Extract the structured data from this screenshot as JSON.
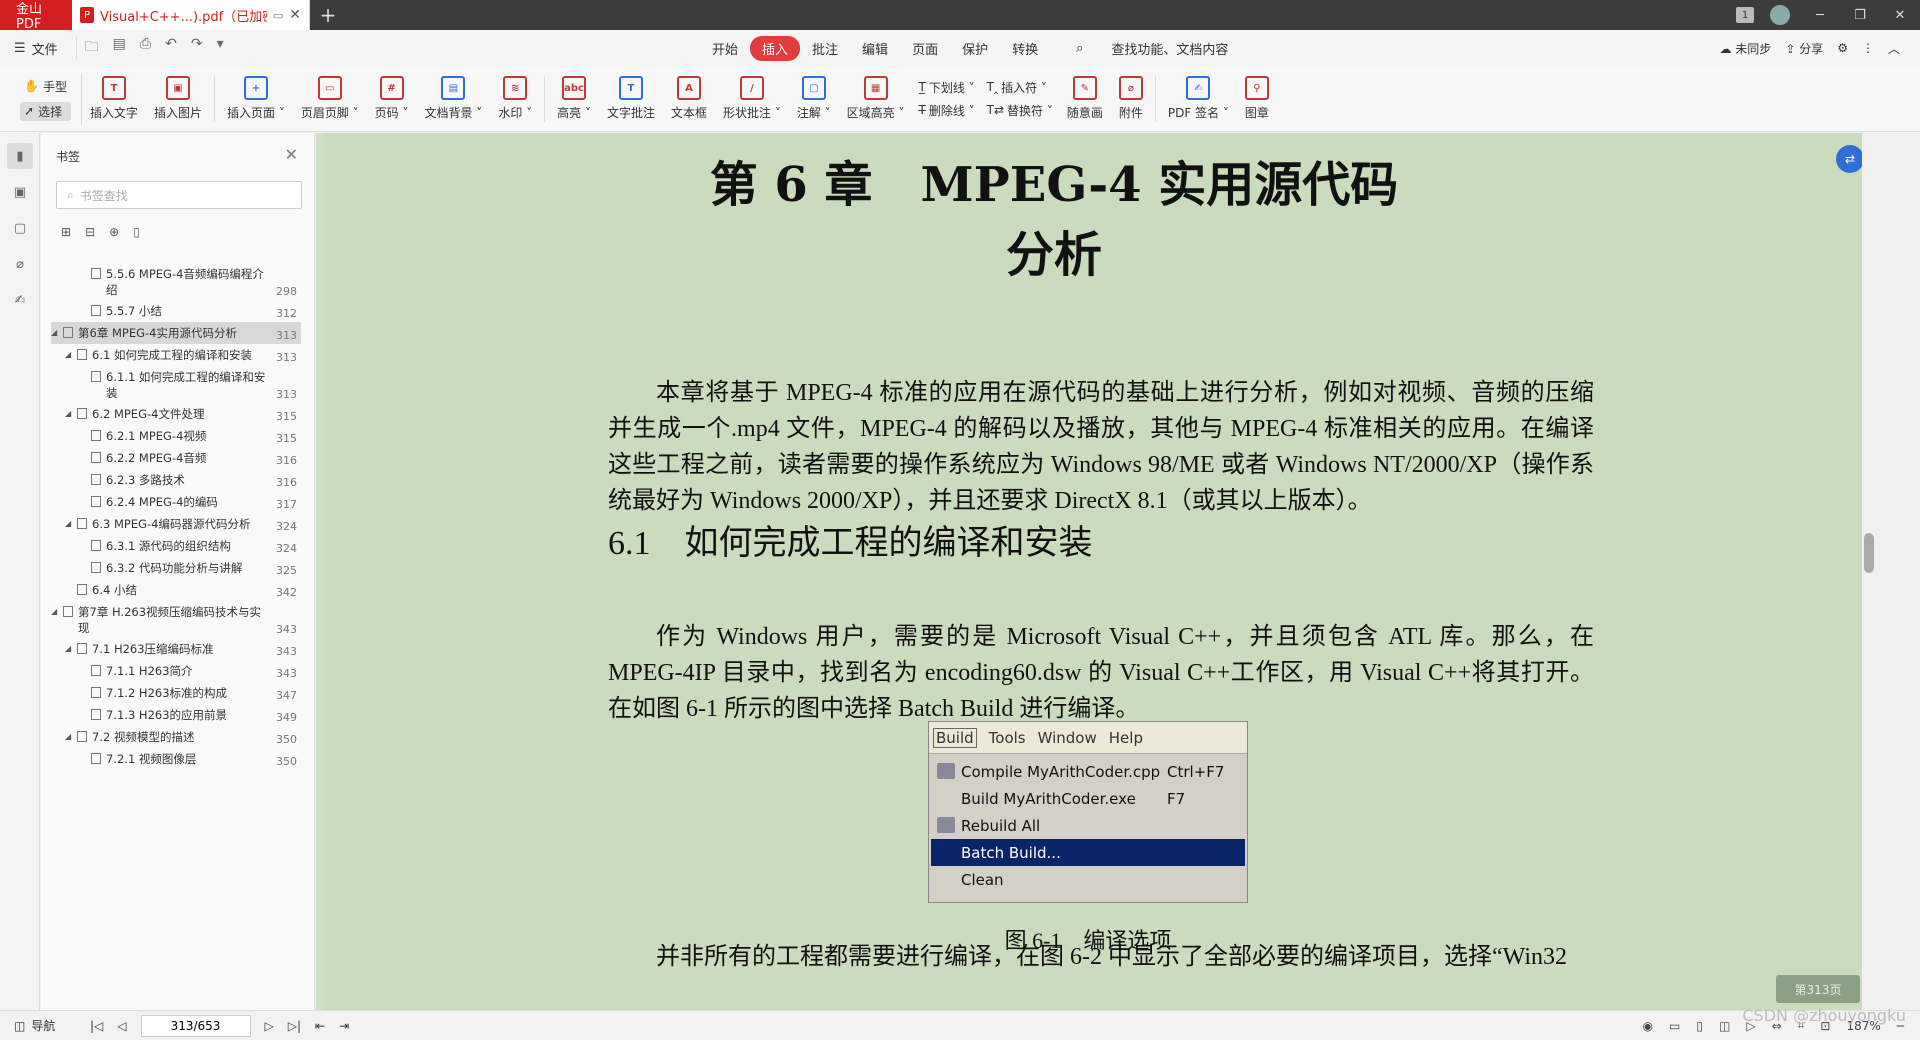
{
  "titlebar": {
    "app_label": "金山PDF",
    "tab_title": "Visual+C++...).pdf（已加密）",
    "new_tab": "+",
    "badge_num": "1"
  },
  "menubar": {
    "file_label": "文件",
    "tabs": [
      "开始",
      "插入",
      "批注",
      "编辑",
      "页面",
      "保护",
      "转换"
    ],
    "active_tab": "插入",
    "search_label": "查找功能、文档内容",
    "sync_label": "未同步",
    "share_label": "分享"
  },
  "toolbar": {
    "hand_label": "手型",
    "select_label": "选择",
    "buttons": [
      {
        "label": "插入文字",
        "icon": "T"
      },
      {
        "label": "插入图片",
        "icon": "▣"
      },
      {
        "label": "插入页面 ˅",
        "icon": "+"
      },
      {
        "label": "页眉页脚 ˅",
        "icon": "▭"
      },
      {
        "label": "页码 ˅",
        "icon": "#"
      },
      {
        "label": "文档背景 ˅",
        "icon": "▤"
      },
      {
        "label": "水印 ˅",
        "icon": "≋"
      },
      {
        "label": "高亮 ˅",
        "icon": "abc"
      },
      {
        "label": "文字批注",
        "icon": "T"
      },
      {
        "label": "文本框",
        "icon": "A"
      },
      {
        "label": "形状批注 ˅",
        "icon": "/"
      },
      {
        "label": "注解 ˅",
        "icon": "▢"
      },
      {
        "label": "区域高亮 ˅",
        "icon": "▦"
      }
    ],
    "pair1": [
      "下划线 ˅",
      "删除线 ˅"
    ],
    "pair2": [
      "插入符 ˅",
      "替换符 ˅"
    ],
    "buttons2": [
      {
        "label": "随意画",
        "icon": "✎"
      },
      {
        "label": "附件",
        "icon": "⌀"
      },
      {
        "label": "PDF 签名 ˅",
        "icon": "✍"
      },
      {
        "label": "图章",
        "icon": "⚲"
      }
    ]
  },
  "panel": {
    "title": "书签",
    "search_placeholder": "书签查找",
    "bookmarks": [
      {
        "text": "5.5.6 MPEG-4音频编码编程介绍",
        "page": "298",
        "level": 2,
        "tri": ""
      },
      {
        "text": "5.5.7 小结",
        "page": "312",
        "level": 2,
        "tri": ""
      },
      {
        "text": "第6章 MPEG-4实用源代码分析",
        "page": "313",
        "level": 0,
        "tri": "◢",
        "sel": true
      },
      {
        "text": "6.1 如何完成工程的编译和安装",
        "page": "313",
        "level": 1,
        "tri": "◢"
      },
      {
        "text": "6.1.1 如何完成工程的编译和安装",
        "page": "313",
        "level": 2,
        "tri": ""
      },
      {
        "text": "6.2 MPEG-4文件处理",
        "page": "315",
        "level": 1,
        "tri": "◢"
      },
      {
        "text": "6.2.1 MPEG-4视频",
        "page": "315",
        "level": 2,
        "tri": ""
      },
      {
        "text": "6.2.2 MPEG-4音频",
        "page": "316",
        "level": 2,
        "tri": ""
      },
      {
        "text": "6.2.3 多路技术",
        "page": "316",
        "level": 2,
        "tri": ""
      },
      {
        "text": "6.2.4 MPEG-4的编码",
        "page": "317",
        "level": 2,
        "tri": ""
      },
      {
        "text": "6.3 MPEG-4编码器源代码分析",
        "page": "324",
        "level": 1,
        "tri": "◢"
      },
      {
        "text": "6.3.1 源代码的组织结构",
        "page": "324",
        "level": 2,
        "tri": ""
      },
      {
        "text": "6.3.2 代码功能分析与讲解",
        "page": "325",
        "level": 2,
        "tri": ""
      },
      {
        "text": "6.4 小结",
        "page": "342",
        "level": 1,
        "tri": ""
      },
      {
        "text": "第7章 H.263视频压缩编码技术与实现",
        "page": "343",
        "level": 0,
        "tri": "◢"
      },
      {
        "text": "7.1 H263压缩编码标准",
        "page": "343",
        "level": 1,
        "tri": "◢"
      },
      {
        "text": "7.1.1 H263简介",
        "page": "343",
        "level": 2,
        "tri": ""
      },
      {
        "text": "7.1.2 H263标准的构成",
        "page": "347",
        "level": 2,
        "tri": ""
      },
      {
        "text": "7.1.3 H263的应用前景",
        "page": "349",
        "level": 2,
        "tri": ""
      },
      {
        "text": "7.2 视频模型的描述",
        "page": "350",
        "level": 1,
        "tri": "◢"
      },
      {
        "text": "7.2.1 视频图像层",
        "page": "350",
        "level": 2,
        "tri": ""
      }
    ]
  },
  "doc": {
    "chapter_title": "第 6 章　MPEG-4 实用源代码分析",
    "para1": "本章将基于 MPEG-4 标准的应用在源代码的基础上进行分析，例如对视频、音频的压缩并生成一个.mp4 文件，MPEG-4 的解码以及播放，其他与 MPEG-4 标准相关的应用。在编译这些工程之前，读者需要的操作系统应为 Windows 98/ME 或者 Windows NT/2000/XP（操作系统最好为 Windows 2000/XP），并且还要求 DirectX 8.1（或其以上版本）。",
    "section_title": "6.1　如何完成工程的编译和安装",
    "para2": "作为 Windows 用户，需要的是 Microsoft Visual C++，并且须包含 ATL 库。那么，在 MPEG-4IP 目录中，找到名为 encoding60.dsw 的 Visual C++工作区，用 Visual C++将其打开。在如图 6-1 所示的图中选择 Batch Build 进行编译。",
    "figure": {
      "menu": [
        "Build",
        "Tools",
        "Window",
        "Help"
      ],
      "items": [
        {
          "label": "Compile MyArithCoder.cpp",
          "shortcut": "Ctrl+F7",
          "icon": true
        },
        {
          "label": "Build MyArithCoder.exe",
          "shortcut": "F7",
          "icon": false
        },
        {
          "label": "Rebuild All",
          "shortcut": "",
          "icon": true
        },
        {
          "label": "Batch Build...",
          "shortcut": "",
          "icon": false,
          "highlighted": true
        },
        {
          "label": "Clean",
          "shortcut": "",
          "icon": false
        }
      ]
    },
    "figure_caption": "图 6-1　编译选项",
    "para3": "并非所有的工程都需要进行编译，在图 6-2 中显示了全部必要的编译项目，选择“Win32",
    "page_badge": "第313页"
  },
  "statusbar": {
    "nav_label": "导航",
    "page_value": "313/653",
    "zoom": "187%"
  },
  "watermark": "CSDN @zhouyongku"
}
